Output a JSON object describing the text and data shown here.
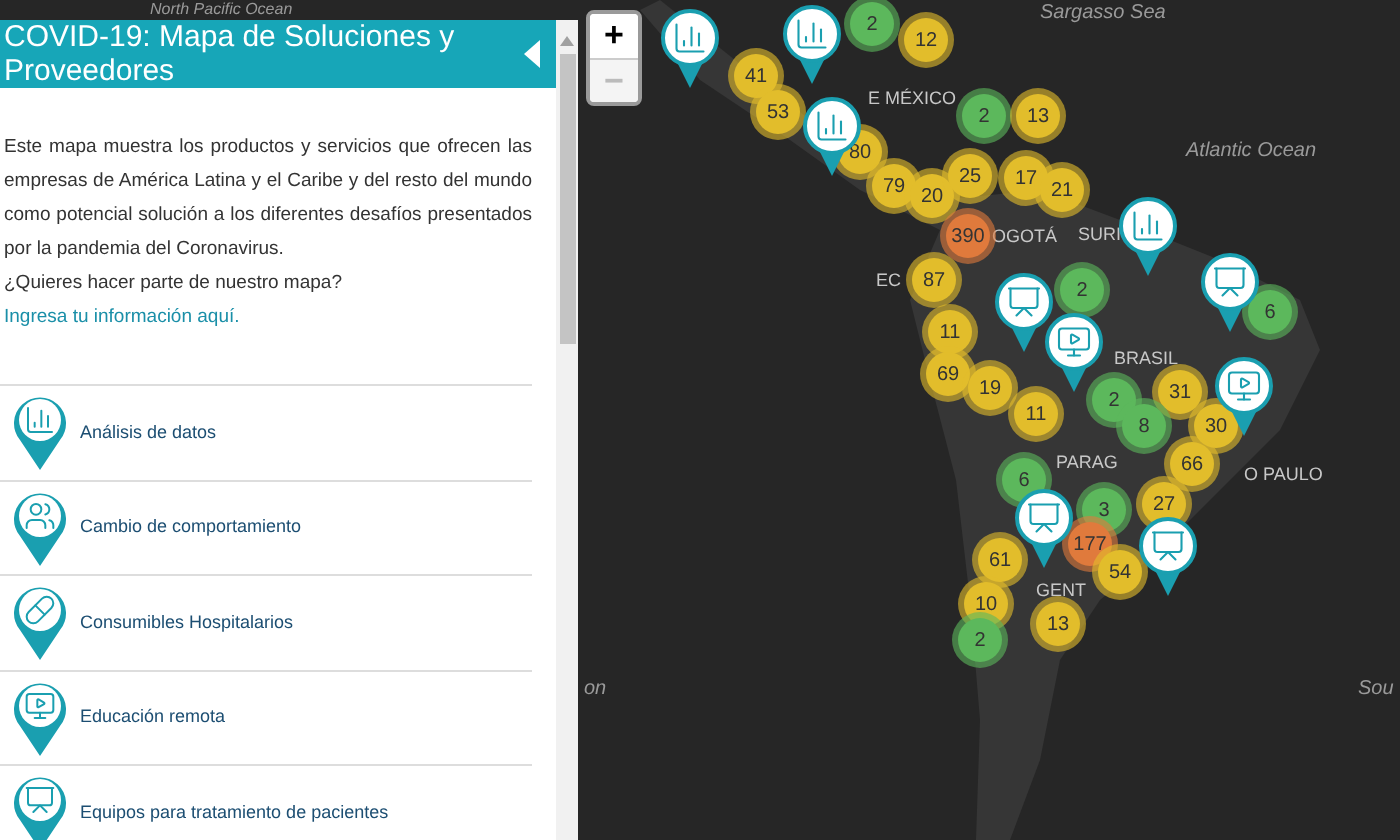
{
  "panel": {
    "title": "COVID-19: Mapa de Soluciones y Proveedores",
    "description": "Este mapa muestra los productos y servicios que ofrecen las empresas de América Latina y el Caribe y del resto del mundo como potencial solución a los diferentes desafíos presentados por la pandemia del Coronavirus.",
    "invite": "¿Quieres hacer parte de nuestro mapa?",
    "invite_link": "Ingresa tu información aquí.",
    "categories": [
      {
        "label": "Análisis de datos"
      },
      {
        "label": "Cambio de comportamiento"
      },
      {
        "label": "Consumibles Hospitalarios"
      },
      {
        "label": "Educación remota"
      },
      {
        "label": "Equipos para tratamiento de pacientes"
      }
    ]
  },
  "zoom_controls": [
    {
      "label": "+",
      "disabled": false
    },
    {
      "label": "−",
      "disabled": true
    }
  ],
  "map_labels": [
    {
      "text": "North Pacific Ocean",
      "kind": "ocean"
    },
    {
      "text": "Sargasso Sea",
      "kind": "ocean"
    },
    {
      "text": "E MÉXICO",
      "kind": "place"
    },
    {
      "text": "Atlantic Ocean",
      "kind": "ocean"
    },
    {
      "text": "OGOTÁ",
      "kind": "place"
    },
    {
      "text": "SURI",
      "kind": "place"
    },
    {
      "text": "EC",
      "kind": "place"
    },
    {
      "text": "BRASIL",
      "kind": "place"
    },
    {
      "text": "PARAG",
      "kind": "place"
    },
    {
      "text": "O PAULO",
      "kind": "place"
    },
    {
      "text": "GENT",
      "kind": "place"
    },
    {
      "text": "on",
      "kind": "ocean"
    },
    {
      "text": "Sou",
      "kind": "ocean"
    }
  ],
  "clusters": [
    {
      "count": "2",
      "color": "#5cb85c"
    },
    {
      "count": "12",
      "color": "#e2bd2b"
    },
    {
      "count": "41",
      "color": "#e2bd2b"
    },
    {
      "count": "53",
      "color": "#e2bd2b"
    },
    {
      "count": "2",
      "color": "#5cb85c"
    },
    {
      "count": "13",
      "color": "#e2bd2b"
    },
    {
      "count": "80",
      "color": "#e2bd2b"
    },
    {
      "count": "79",
      "color": "#e2bd2b"
    },
    {
      "count": "20",
      "color": "#e2bd2b"
    },
    {
      "count": "25",
      "color": "#e2bd2b"
    },
    {
      "count": "17",
      "color": "#e2bd2b"
    },
    {
      "count": "21",
      "color": "#e2bd2b"
    },
    {
      "count": "390",
      "color": "#e07a3c"
    },
    {
      "count": "87",
      "color": "#e2bd2b"
    },
    {
      "count": "2",
      "color": "#5cb85c"
    },
    {
      "count": "6",
      "color": "#5cb85c"
    },
    {
      "count": "11",
      "color": "#e2bd2b"
    },
    {
      "count": "69",
      "color": "#e2bd2b"
    },
    {
      "count": "19",
      "color": "#e2bd2b"
    },
    {
      "count": "11",
      "color": "#e2bd2b"
    },
    {
      "count": "2",
      "color": "#5cb85c"
    },
    {
      "count": "31",
      "color": "#e2bd2b"
    },
    {
      "count": "8",
      "color": "#5cb85c"
    },
    {
      "count": "30",
      "color": "#e2bd2b"
    },
    {
      "count": "66",
      "color": "#e2bd2b"
    },
    {
      "count": "6",
      "color": "#5cb85c"
    },
    {
      "count": "3",
      "color": "#5cb85c"
    },
    {
      "count": "27",
      "color": "#e2bd2b"
    },
    {
      "count": "61",
      "color": "#e2bd2b"
    },
    {
      "count": "177",
      "color": "#e07a3c"
    },
    {
      "count": "54",
      "color": "#e2bd2b"
    },
    {
      "count": "10",
      "color": "#e2bd2b"
    },
    {
      "count": "13",
      "color": "#e2bd2b"
    },
    {
      "count": "2",
      "color": "#5cb85c"
    }
  ]
}
